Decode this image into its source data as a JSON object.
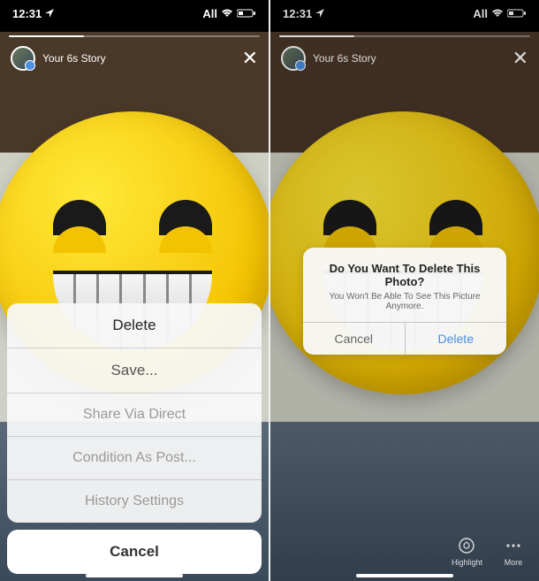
{
  "status": {
    "time": "12:31",
    "carrier": "All"
  },
  "story": {
    "title": "Your 6s Story"
  },
  "action_sheet": {
    "items": [
      {
        "label": "Delete",
        "style": "destructive"
      },
      {
        "label": "Save...",
        "style": "normal"
      },
      {
        "label": "Share Via Direct",
        "style": "faded"
      },
      {
        "label": "Condition As Post...",
        "style": "faded"
      },
      {
        "label": "History Settings",
        "style": "faded"
      }
    ],
    "cancel": "Cancel"
  },
  "alert": {
    "title": "Do You Want To Delete This Photo?",
    "message": "You Won't Be Able To See This Picture Anymore.",
    "cancel": "Cancel",
    "confirm": "Delete"
  },
  "toolbar": {
    "highlight": "Highlight",
    "more": "More"
  }
}
